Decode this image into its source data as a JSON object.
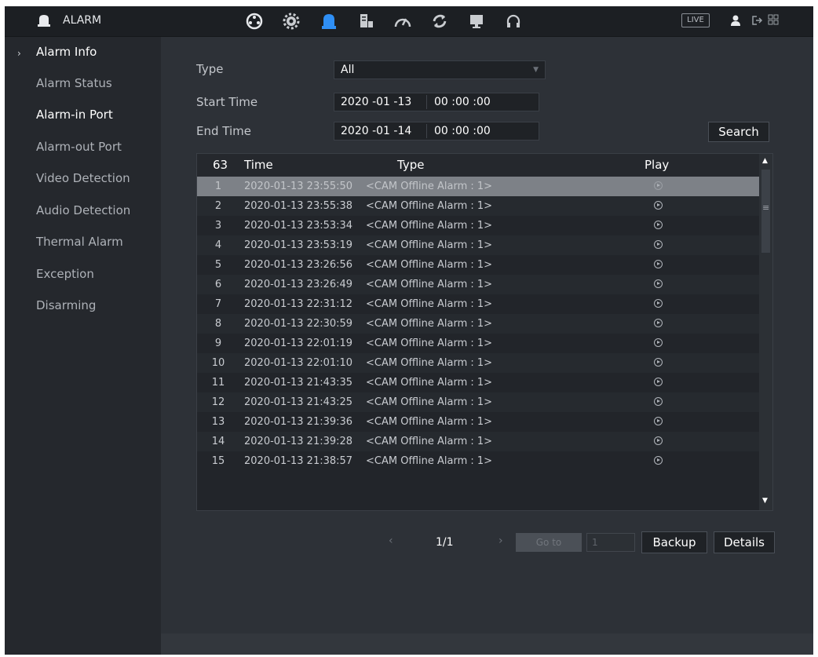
{
  "header": {
    "title": "ALARM",
    "live_label": "LIVE",
    "nav_icons": [
      "camera-icon",
      "settings-icon",
      "alarm-icon",
      "storage-icon",
      "performance-icon",
      "refresh-icon",
      "display-icon",
      "headset-icon"
    ]
  },
  "sidebar": {
    "items": [
      {
        "label": "Alarm Info"
      },
      {
        "label": "Alarm Status"
      },
      {
        "label": "Alarm-in Port"
      },
      {
        "label": "Alarm-out Port"
      },
      {
        "label": "Video Detection"
      },
      {
        "label": "Audio Detection"
      },
      {
        "label": "Thermal Alarm"
      },
      {
        "label": "Exception"
      },
      {
        "label": "Disarming"
      }
    ]
  },
  "filters": {
    "type_label": "Type",
    "type_value": "All",
    "start_label": "Start Time",
    "start_date": "2020 -01 -13",
    "start_time": "00 :00 :00",
    "end_label": "End Time",
    "end_date": "2020 -01 -14",
    "end_time": "00 :00 :00",
    "search_label": "Search"
  },
  "table": {
    "count": "63",
    "headers": {
      "time": "Time",
      "type": "Type",
      "play": "Play"
    },
    "rows": [
      {
        "no": "1",
        "time": "2020-01-13 23:55:50",
        "type": "<CAM Offline Alarm : 1>"
      },
      {
        "no": "2",
        "time": "2020-01-13 23:55:38",
        "type": "<CAM Offline Alarm : 1>"
      },
      {
        "no": "3",
        "time": "2020-01-13 23:53:34",
        "type": "<CAM Offline Alarm : 1>"
      },
      {
        "no": "4",
        "time": "2020-01-13 23:53:19",
        "type": "<CAM Offline Alarm : 1>"
      },
      {
        "no": "5",
        "time": "2020-01-13 23:26:56",
        "type": "<CAM Offline Alarm : 1>"
      },
      {
        "no": "6",
        "time": "2020-01-13 23:26:49",
        "type": "<CAM Offline Alarm : 1>"
      },
      {
        "no": "7",
        "time": "2020-01-13 22:31:12",
        "type": "<CAM Offline Alarm : 1>"
      },
      {
        "no": "8",
        "time": "2020-01-13 22:30:59",
        "type": "<CAM Offline Alarm : 1>"
      },
      {
        "no": "9",
        "time": "2020-01-13 22:01:19",
        "type": "<CAM Offline Alarm : 1>"
      },
      {
        "no": "10",
        "time": "2020-01-13 22:01:10",
        "type": "<CAM Offline Alarm : 1>"
      },
      {
        "no": "11",
        "time": "2020-01-13 21:43:35",
        "type": "<CAM Offline Alarm : 1>"
      },
      {
        "no": "12",
        "time": "2020-01-13 21:43:25",
        "type": "<CAM Offline Alarm : 1>"
      },
      {
        "no": "13",
        "time": "2020-01-13 21:39:36",
        "type": "<CAM Offline Alarm : 1>"
      },
      {
        "no": "14",
        "time": "2020-01-13 21:39:28",
        "type": "<CAM Offline Alarm : 1>"
      },
      {
        "no": "15",
        "time": "2020-01-13 21:38:57",
        "type": "<CAM Offline Alarm : 1>"
      }
    ]
  },
  "pager": {
    "page_label": "1/1",
    "goto_label": "Go to",
    "page_input": "1",
    "backup_label": "Backup",
    "details_label": "Details"
  }
}
